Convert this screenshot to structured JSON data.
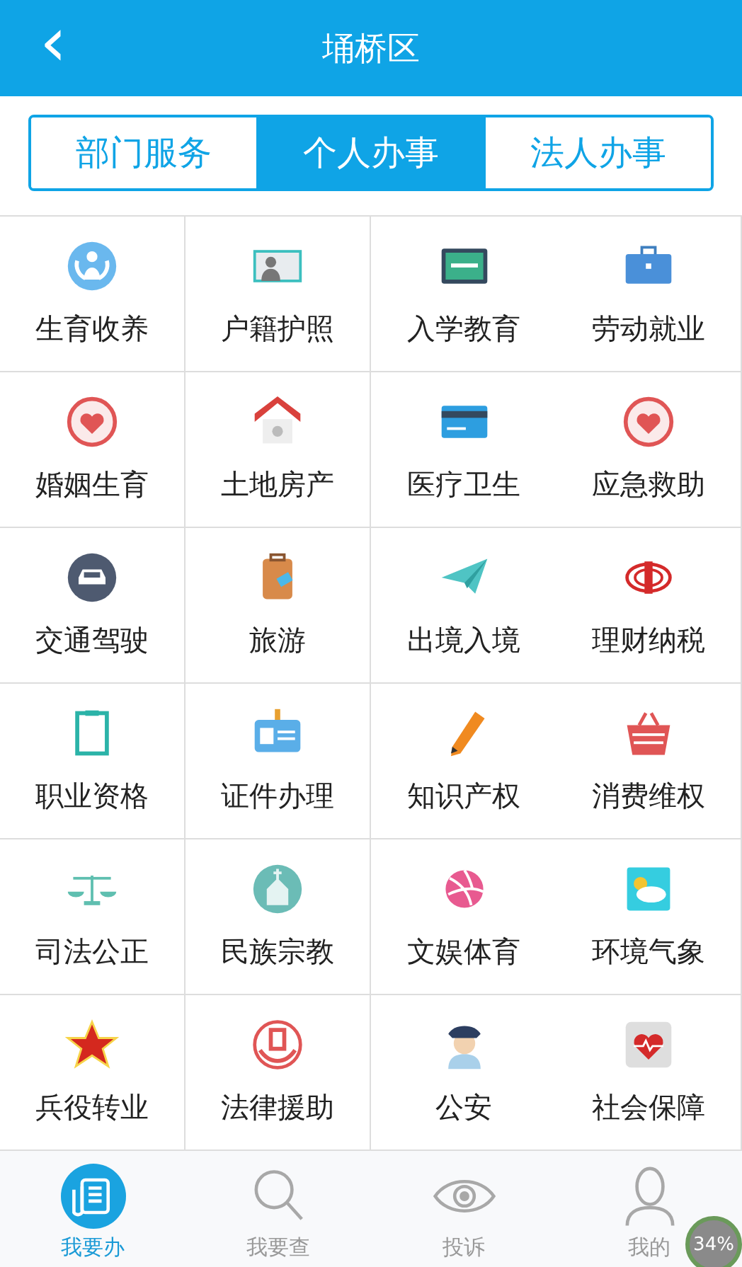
{
  "header": {
    "back": "‹",
    "title": "埇桥区"
  },
  "tabs": [
    {
      "label": "部门服务",
      "selected": false
    },
    {
      "label": "个人办事",
      "selected": true
    },
    {
      "label": "法人办事",
      "selected": false
    }
  ],
  "services": [
    {
      "label": "生育收养"
    },
    {
      "label": "户籍护照"
    },
    {
      "label": "入学教育"
    },
    {
      "label": "劳动就业"
    },
    {
      "label": "婚姻生育"
    },
    {
      "label": "土地房产"
    },
    {
      "label": "医疗卫生"
    },
    {
      "label": "应急救助"
    },
    {
      "label": "交通驾驶"
    },
    {
      "label": "旅游"
    },
    {
      "label": "出境入境"
    },
    {
      "label": "理财纳税"
    },
    {
      "label": "职业资格"
    },
    {
      "label": "证件办理"
    },
    {
      "label": "知识产权"
    },
    {
      "label": "消费维权"
    },
    {
      "label": "司法公正"
    },
    {
      "label": "民族宗教"
    },
    {
      "label": "文娱体育"
    },
    {
      "label": "环境气象"
    },
    {
      "label": "兵役转业"
    },
    {
      "label": "法律援助"
    },
    {
      "label": "公安"
    },
    {
      "label": "社会保障"
    }
  ],
  "bottom_nav": [
    {
      "label": "我要办",
      "selected": true
    },
    {
      "label": "我要查",
      "selected": false
    },
    {
      "label": "投诉",
      "selected": false
    },
    {
      "label": "我的",
      "selected": false
    }
  ],
  "floating_badge": "34%"
}
